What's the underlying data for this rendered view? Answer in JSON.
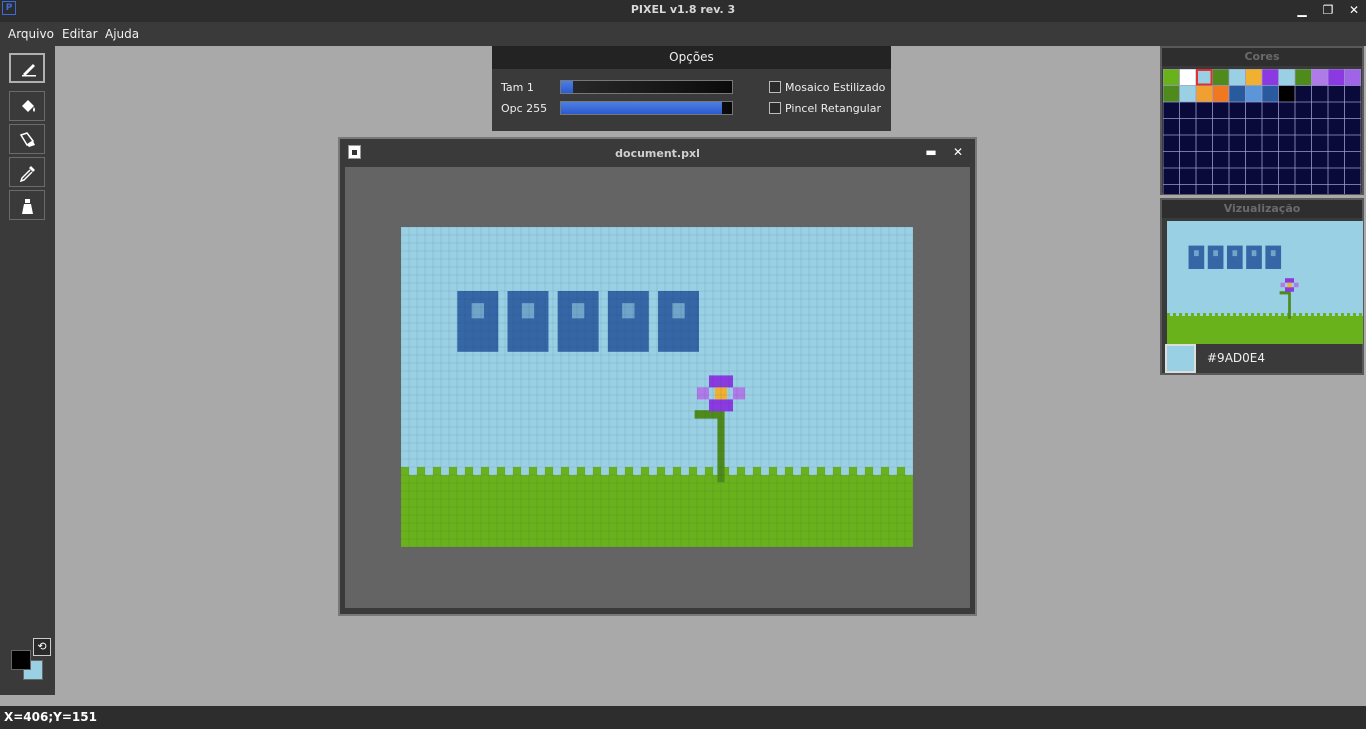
{
  "app": {
    "title": "PIXEL v1.8 rev. 3",
    "icon_letter": "P"
  },
  "window_controls": {
    "minimize": "▁",
    "restore": "❐",
    "close": "✕"
  },
  "menu": [
    "Arquivo",
    "Editar",
    "Ajuda"
  ],
  "tools": [
    {
      "name": "pencil-icon",
      "active": true
    },
    {
      "name": "paint-bucket-icon",
      "active": false
    },
    {
      "name": "eraser-icon",
      "active": false
    },
    {
      "name": "eyedropper-icon",
      "active": false
    },
    {
      "name": "spray-bottle-icon",
      "active": false
    }
  ],
  "colors": {
    "foreground": "#000000",
    "background": "#9AD0E4"
  },
  "options": {
    "title": "Opções",
    "size_label": "Tam 1",
    "size_fraction": 0.07,
    "opacity_label": "Opc 255",
    "opacity_fraction": 0.94,
    "mosaic_label": "Mosaico Estilizado",
    "mosaic_checked": false,
    "rect_brush_label": "Pincel Retangular",
    "rect_brush_checked": false
  },
  "document": {
    "title": "document.pxl",
    "minimize": "▬",
    "close": "✕"
  },
  "palette": {
    "title": "Cores",
    "swatches": [
      "#6ab21c",
      "#ffffff",
      "#9ad0e4",
      "#4f8a1c",
      "#9ad0e4",
      "#f0b030",
      "#8a3ae0",
      "#9ad0e4",
      "#4f8a1c",
      "#b07ae8",
      "#8a3ae0",
      "#a064e6",
      "#4f8a1c",
      "#9ad0e4",
      "#f0a030",
      "#f07820",
      "#2a5a9e",
      "#5a96d8",
      "#2a5a9e",
      "#000000"
    ],
    "selected_index": 2
  },
  "preview": {
    "title": "Vizualização",
    "color_hex": "#9AD0E4"
  },
  "status": {
    "coords": "X=406;Y=151"
  },
  "palette_colors": {
    "sky": "#9ad0e4",
    "grass": "#6ab21c",
    "text_dark": "#2a5a9e",
    "text_light": "#5a96d8",
    "stem": "#4f8a1c",
    "petal": "#8a3ae0",
    "petal_light": "#b07ae8",
    "center": "#f0b030"
  }
}
